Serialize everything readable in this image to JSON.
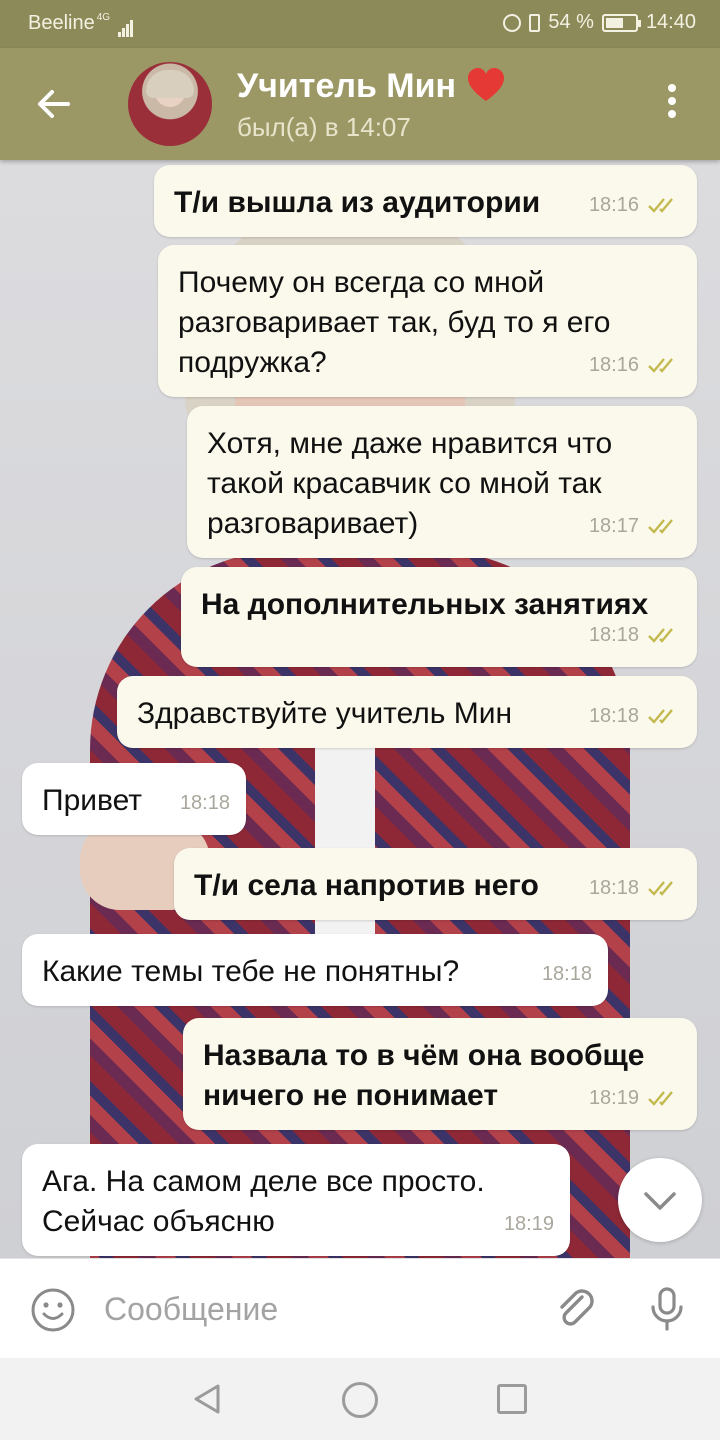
{
  "status_bar": {
    "carrier": "Beeline",
    "network": "4G",
    "battery_percent": "54 %",
    "battery_level": 0.54,
    "time": "14:40"
  },
  "header": {
    "contact_name": "Учитель Мин",
    "status": "был(а) в 14:07",
    "icons": [
      "back-arrow-icon",
      "avatar",
      "heart-emoji",
      "more-vert-icon"
    ]
  },
  "messages": [
    {
      "side": "out",
      "bold": true,
      "text": "Т/и вышла из аудитории",
      "time": "18:16",
      "read": true
    },
    {
      "side": "out",
      "bold": false,
      "text": "Почему он всегда со мной разговаривает так, буд то я его подружка?",
      "time": "18:16",
      "read": true
    },
    {
      "side": "out",
      "bold": false,
      "text": "Хотя, мне даже нравится что такой красавчик со мной так разговаривает)",
      "time": "18:17",
      "read": true
    },
    {
      "side": "out",
      "bold": true,
      "text": "На дополнительных занятиях",
      "time": "18:18",
      "read": true
    },
    {
      "side": "out",
      "bold": false,
      "text": "Здравствуйте учитель Мин",
      "time": "18:18",
      "read": true
    },
    {
      "side": "in",
      "bold": false,
      "text": "Привет",
      "time": "18:18",
      "read": false
    },
    {
      "side": "out",
      "bold": true,
      "text": "Т/и села напротив него",
      "time": "18:18",
      "read": true
    },
    {
      "side": "in",
      "bold": false,
      "text": "Какие темы тебе не понятны?",
      "time": "18:18",
      "read": false
    },
    {
      "side": "out",
      "bold": true,
      "text": "Назвала то в чём она вообще ничего не понимает",
      "time": "18:19",
      "read": true
    },
    {
      "side": "in",
      "bold": false,
      "text": "Ага. На самом деле все просто. Сейчас объясню",
      "time": "18:19",
      "read": false
    }
  ],
  "input": {
    "placeholder": "Сообщение",
    "icons": [
      "emoji-icon",
      "attach-clip-icon",
      "microphone-icon"
    ]
  },
  "nav_bar": {
    "icons": [
      "nav-back-icon",
      "nav-home-icon",
      "nav-recents-icon"
    ]
  },
  "colors": {
    "header": "#9b9865",
    "status_bar": "#8d8a59",
    "outgoing_bubble": "#fbf9ec",
    "incoming_bubble": "#ffffff",
    "read_ticks": "#c3b94e"
  }
}
